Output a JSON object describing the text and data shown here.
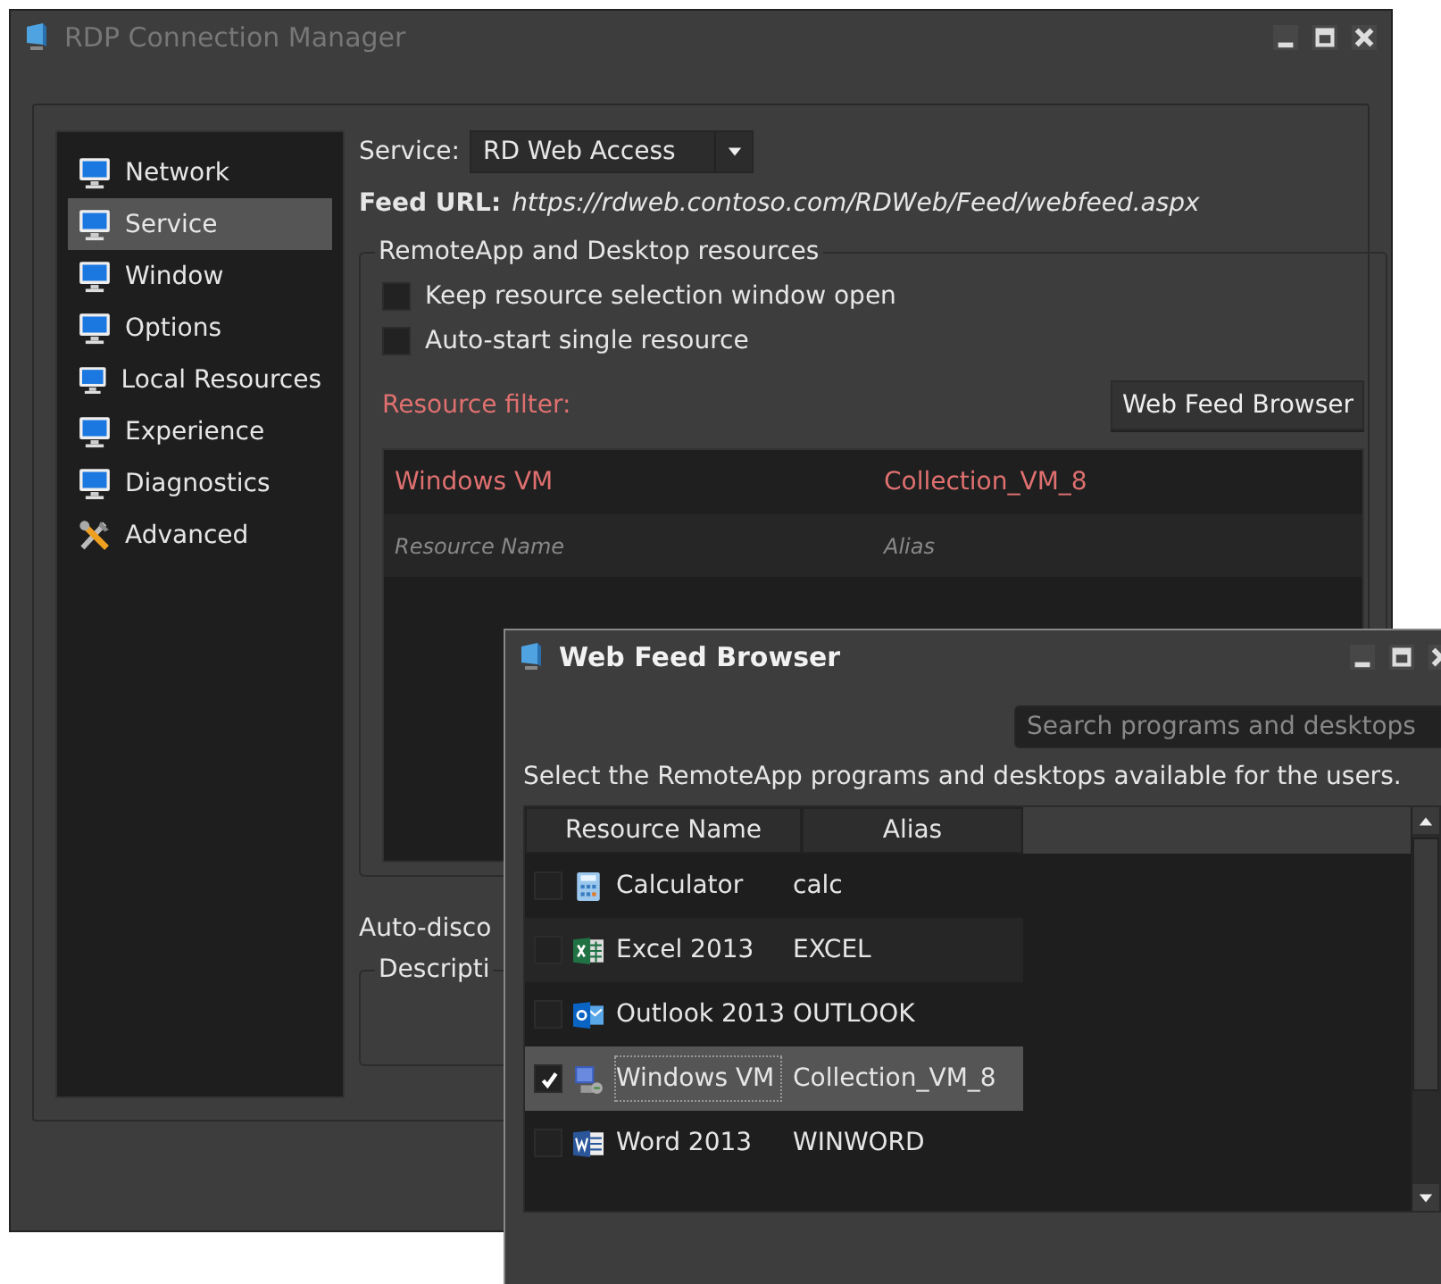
{
  "main_window": {
    "title": "RDP Connection Manager"
  },
  "sidebar": {
    "items": [
      {
        "label": "Network",
        "kind": "monitor",
        "selected": false
      },
      {
        "label": "Service",
        "kind": "monitor",
        "selected": true
      },
      {
        "label": "Window",
        "kind": "monitor",
        "selected": false
      },
      {
        "label": "Options",
        "kind": "monitor",
        "selected": false
      },
      {
        "label": "Local Resources",
        "kind": "monitor",
        "selected": false
      },
      {
        "label": "Experience",
        "kind": "monitor",
        "selected": false
      },
      {
        "label": "Diagnostics",
        "kind": "monitor",
        "selected": false
      },
      {
        "label": "Advanced",
        "kind": "tools",
        "selected": false
      }
    ]
  },
  "service": {
    "label": "Service:",
    "value": "RD Web Access"
  },
  "feed_url": {
    "label": "Feed URL:",
    "value": "https://rdweb.contoso.com/RDWeb/Feed/webfeed.aspx"
  },
  "resources_group": {
    "title": "RemoteApp and Desktop resources",
    "options": [
      {
        "label": "Keep resource selection window open",
        "checked": false
      },
      {
        "label": "Auto-start single resource",
        "checked": false
      }
    ],
    "filter_label": "Resource filter:",
    "browse_button": "Web Feed Browser",
    "filter_rows": [
      {
        "name": "Windows VM",
        "alias": "Collection_VM_8"
      }
    ],
    "new_row": {
      "name_placeholder": "Resource Name",
      "alias_placeholder": "Alias"
    }
  },
  "auto_disconnect_label": "Auto-disco",
  "description_group": {
    "title": "Descripti"
  },
  "dialog": {
    "title": "Web Feed Browser",
    "search": {
      "placeholder": "Search programs and desktops"
    },
    "instructions": "Select the RemoteApp programs and desktops available for the users.",
    "columns": [
      "Resource Name",
      "Alias"
    ],
    "rows": [
      {
        "name": "Calculator",
        "alias": "calc",
        "kind": "calculator",
        "checked": false,
        "selected": false
      },
      {
        "name": "Excel 2013",
        "alias": "EXCEL",
        "kind": "spreadsheet",
        "checked": false,
        "selected": false
      },
      {
        "name": "Outlook 2013",
        "alias": "OUTLOOK",
        "kind": "mail",
        "checked": false,
        "selected": false
      },
      {
        "name": "Windows VM",
        "alias": "Collection_VM_8",
        "kind": "computer",
        "checked": true,
        "selected": true
      },
      {
        "name": "Word 2013",
        "alias": "WINWORD",
        "kind": "document",
        "checked": false,
        "selected": false
      }
    ]
  }
}
